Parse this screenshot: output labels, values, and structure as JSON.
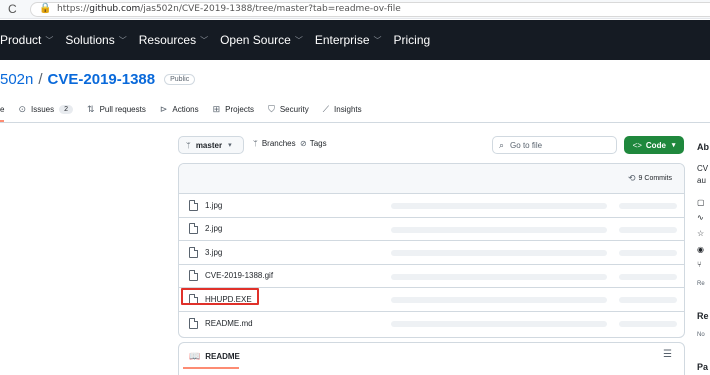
{
  "browser": {
    "reload_glyph": "C",
    "lock_glyph": "🔒",
    "url_prefix": "https://",
    "url_host": "github.com",
    "url_path": "/jas502n/CVE-2019-1388/tree/master?tab=readme-ov-file"
  },
  "nav": {
    "items": [
      "Product",
      "Solutions",
      "Resources",
      "Open Source",
      "Enterprise",
      "Pricing"
    ]
  },
  "repo": {
    "owner": "502n",
    "name": "CVE-2019-1388",
    "visibility": "Public"
  },
  "tabs": {
    "code": "e",
    "issues": "Issues",
    "issues_count": "2",
    "pulls": "Pull requests",
    "actions": "Actions",
    "projects": "Projects",
    "security": "Security",
    "insights": "Insights"
  },
  "toolbar": {
    "branch": "master",
    "branches": "Branches",
    "tags": "Tags",
    "search_placeholder": "Go to file",
    "code_button": "Code"
  },
  "files": {
    "commits_label": "9 Commits",
    "rows": [
      {
        "name": "1.jpg"
      },
      {
        "name": "2.jpg"
      },
      {
        "name": "3.jpg"
      },
      {
        "name": "CVE-2019-1388.gif"
      },
      {
        "name": "HHUPD.EXE"
      },
      {
        "name": "README.md"
      }
    ]
  },
  "readme": {
    "tab_label": "README"
  },
  "sidebar": {
    "about_heading": "Ab",
    "desc_line1": "CV",
    "desc_line2": "au",
    "report_label": "Re",
    "releases_heading": "Re",
    "no_releases": "No",
    "packages_heading": "Pa"
  },
  "colors": {
    "header_bg": "#151b23",
    "link": "#0969da",
    "code_button": "#1f883d",
    "highlight_box": "#e0312a",
    "active_tab": "#fd8c73"
  }
}
